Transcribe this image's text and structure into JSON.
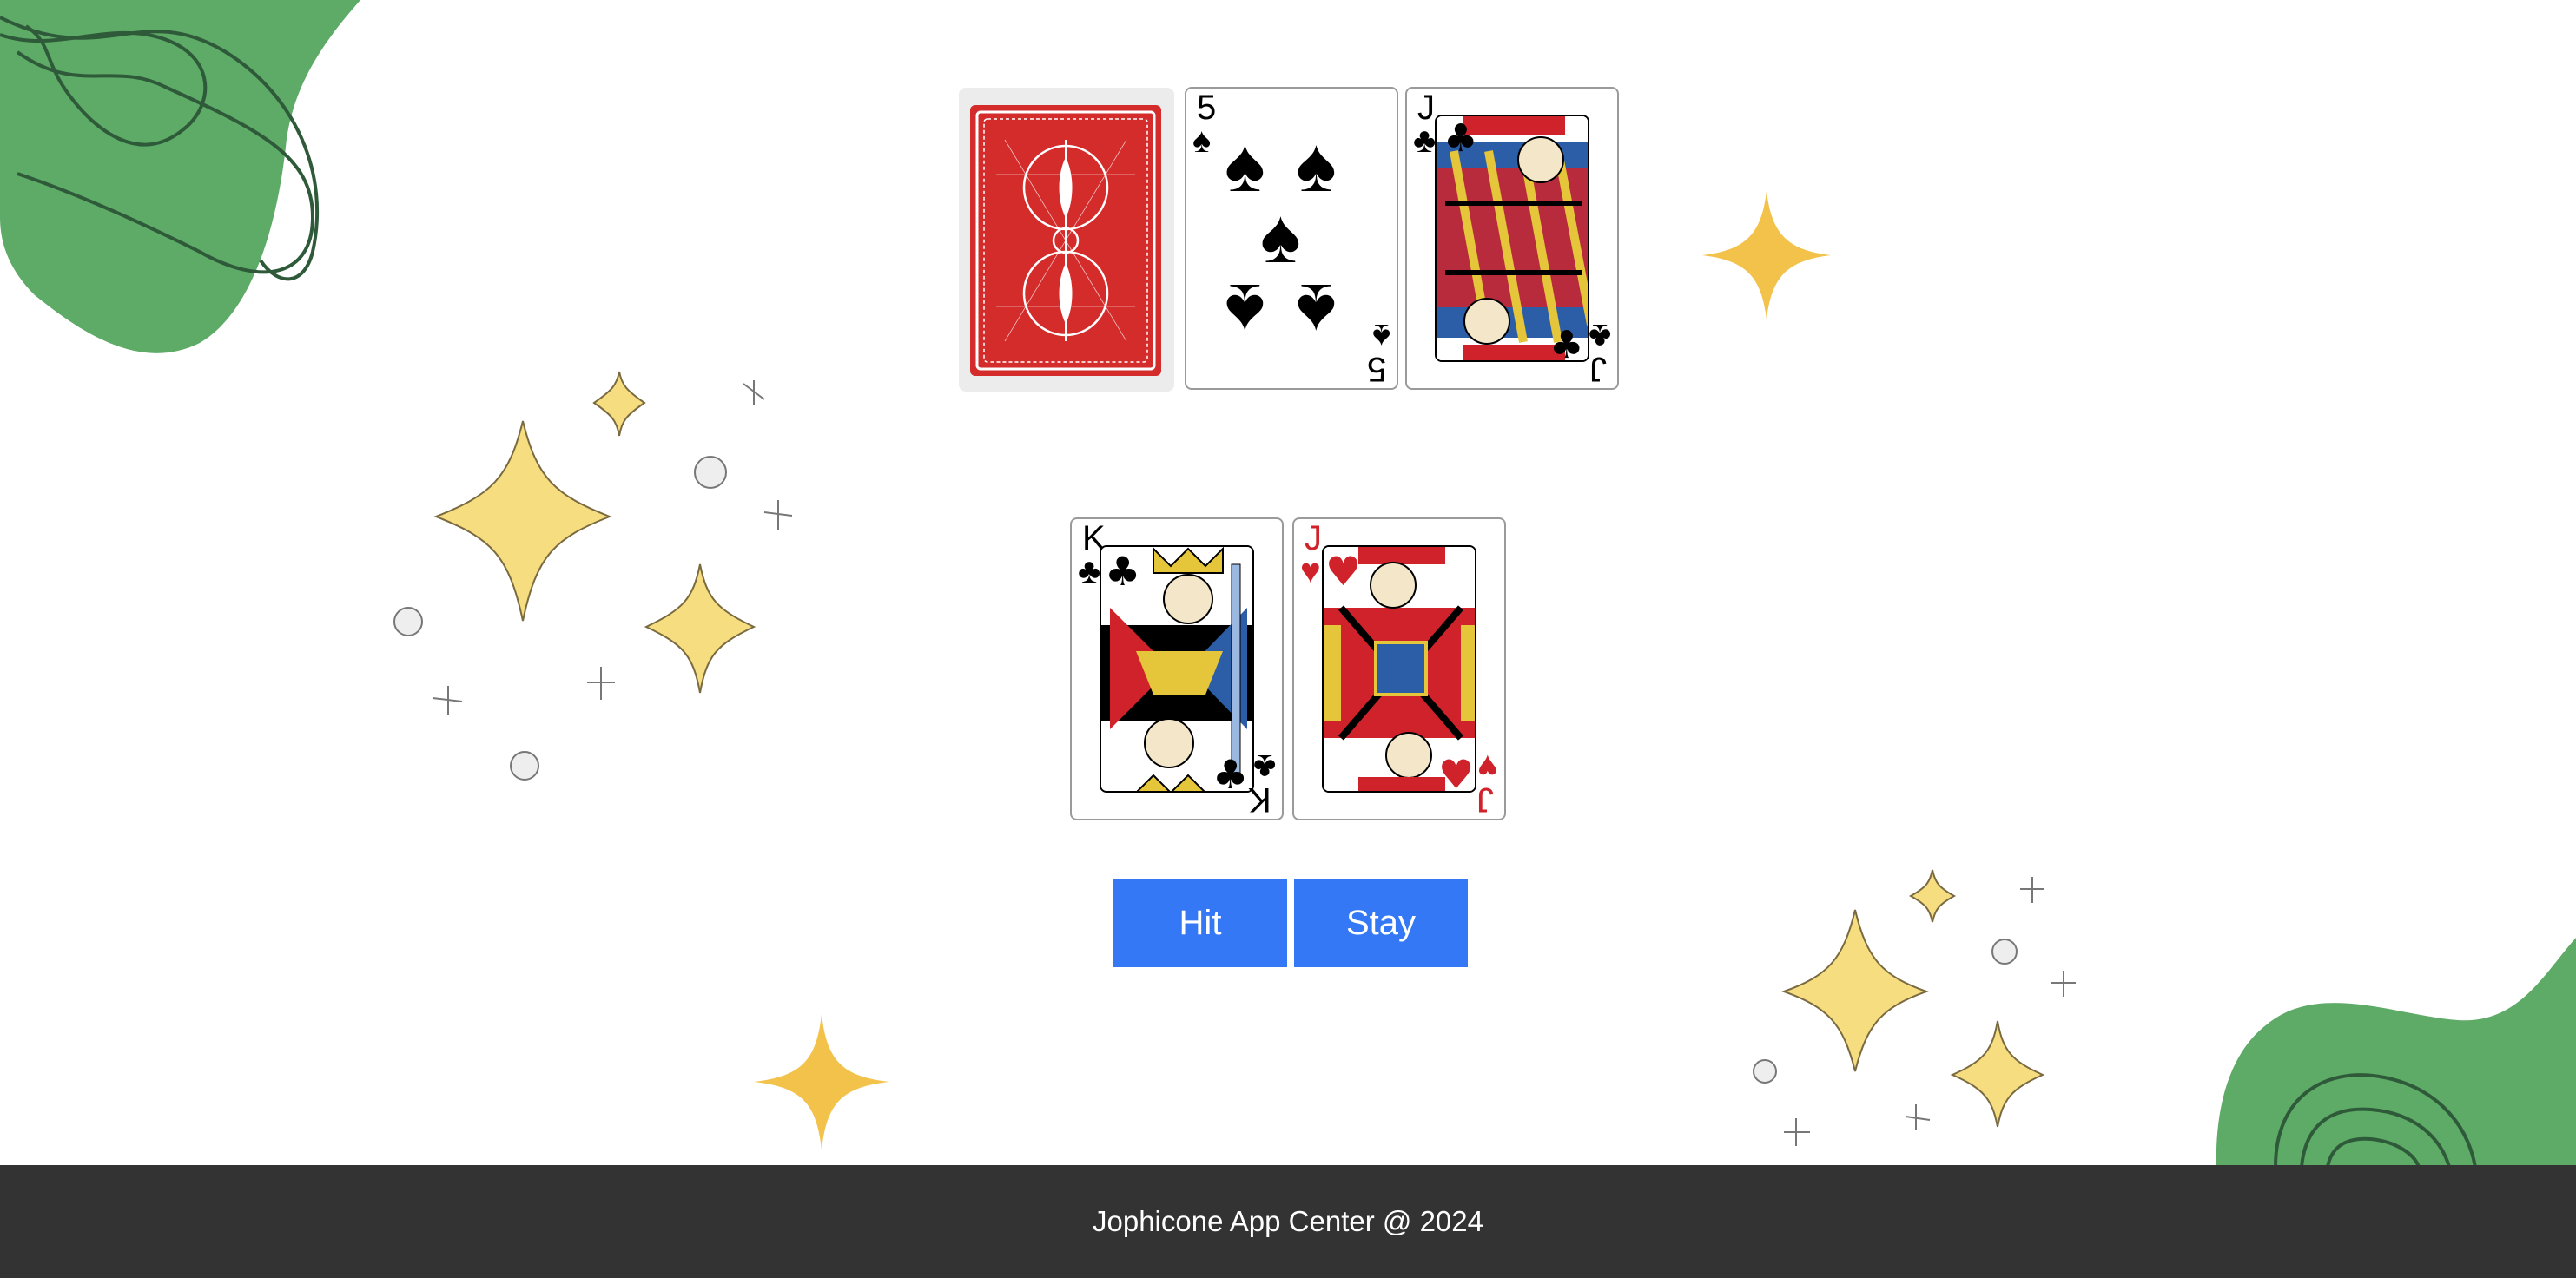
{
  "dealer_hand": {
    "cards": [
      {
        "face": "back"
      },
      {
        "rank": "5",
        "suit": "♠",
        "color": "black"
      },
      {
        "rank": "J",
        "suit": "♣",
        "color": "black"
      }
    ]
  },
  "player_hand": {
    "cards": [
      {
        "rank": "K",
        "suit": "♣",
        "color": "black"
      },
      {
        "rank": "J",
        "suit": "♥",
        "color": "red"
      }
    ]
  },
  "controls": {
    "hit_label": "Hit",
    "stay_label": "Stay",
    "button_color": "#3478f6"
  },
  "footer": {
    "text": "Jophicone App Center @ 2024"
  },
  "colors": {
    "accent_green": "#5dab67",
    "sparkle_yellow": "#f4d77a",
    "star_gold": "#f2c24a",
    "footer_bg": "#333333"
  }
}
